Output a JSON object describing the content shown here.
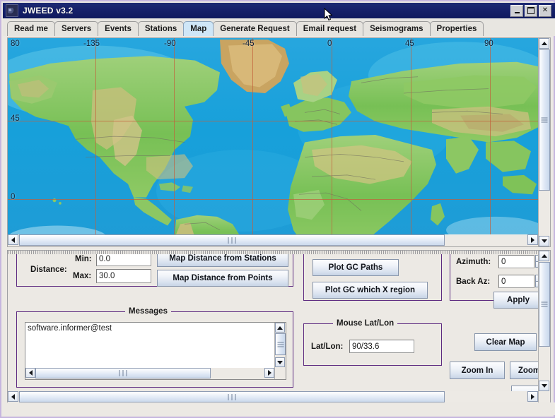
{
  "window": {
    "title": "JWEED v3.2",
    "icon": "app-icon",
    "buttons": {
      "minimize": "_",
      "maximize": "□",
      "close": "✕"
    }
  },
  "tabs": [
    {
      "label": "Read me",
      "selected": false
    },
    {
      "label": "Servers",
      "selected": false
    },
    {
      "label": "Events",
      "selected": false
    },
    {
      "label": "Stations",
      "selected": false
    },
    {
      "label": "Map",
      "selected": true
    },
    {
      "label": "Generate Request",
      "selected": false
    },
    {
      "label": "Email request",
      "selected": false
    },
    {
      "label": "Seismograms",
      "selected": false
    },
    {
      "label": "Properties",
      "selected": false
    }
  ],
  "map": {
    "lon_labels": [
      "-135",
      "-90",
      "-45",
      "0",
      "45",
      "90"
    ],
    "lat_labels": [
      "80",
      "45",
      "0"
    ],
    "h_scrollbar": {
      "left_arrow": "◀",
      "right_arrow": "▶"
    },
    "v_scrollbar": {
      "up_arrow": "▲",
      "down_arrow": "▼"
    }
  },
  "distance_panel": {
    "label": "Distance:",
    "min_label": "Min:",
    "min_value": "0.0",
    "max_label": "Max:",
    "max_value": "30.0",
    "buttons": [
      "Map Distance from Stations",
      "Map Distance from Points"
    ]
  },
  "gc_panel": {
    "buttons": [
      "Plot GC Paths",
      "Plot GC which X region"
    ]
  },
  "messages_panel": {
    "legend": "Messages",
    "text": "software.informer@test"
  },
  "mouse_panel": {
    "legend": "Mouse Lat/Lon",
    "label": "Lat/Lon:",
    "value": "90/33.6"
  },
  "azimuth_panel": {
    "azimuth_label": "Azimuth:",
    "azimuth_value": "0",
    "back_az_label": "Back Az:",
    "back_az_value": "0",
    "apply_label": "Apply"
  },
  "map_controls": {
    "clear_label": "Clear Map",
    "zoom_in_label": "Zoom In",
    "zoom_out_label": "Zoom Out"
  },
  "colors": {
    "titlebar": "#16216b",
    "panel_border": "#5d2a80",
    "selected_tab": "#cfe6f7",
    "grid": "#c2603a",
    "ocean": "#1f9fd8",
    "land": "#7cc15a"
  }
}
